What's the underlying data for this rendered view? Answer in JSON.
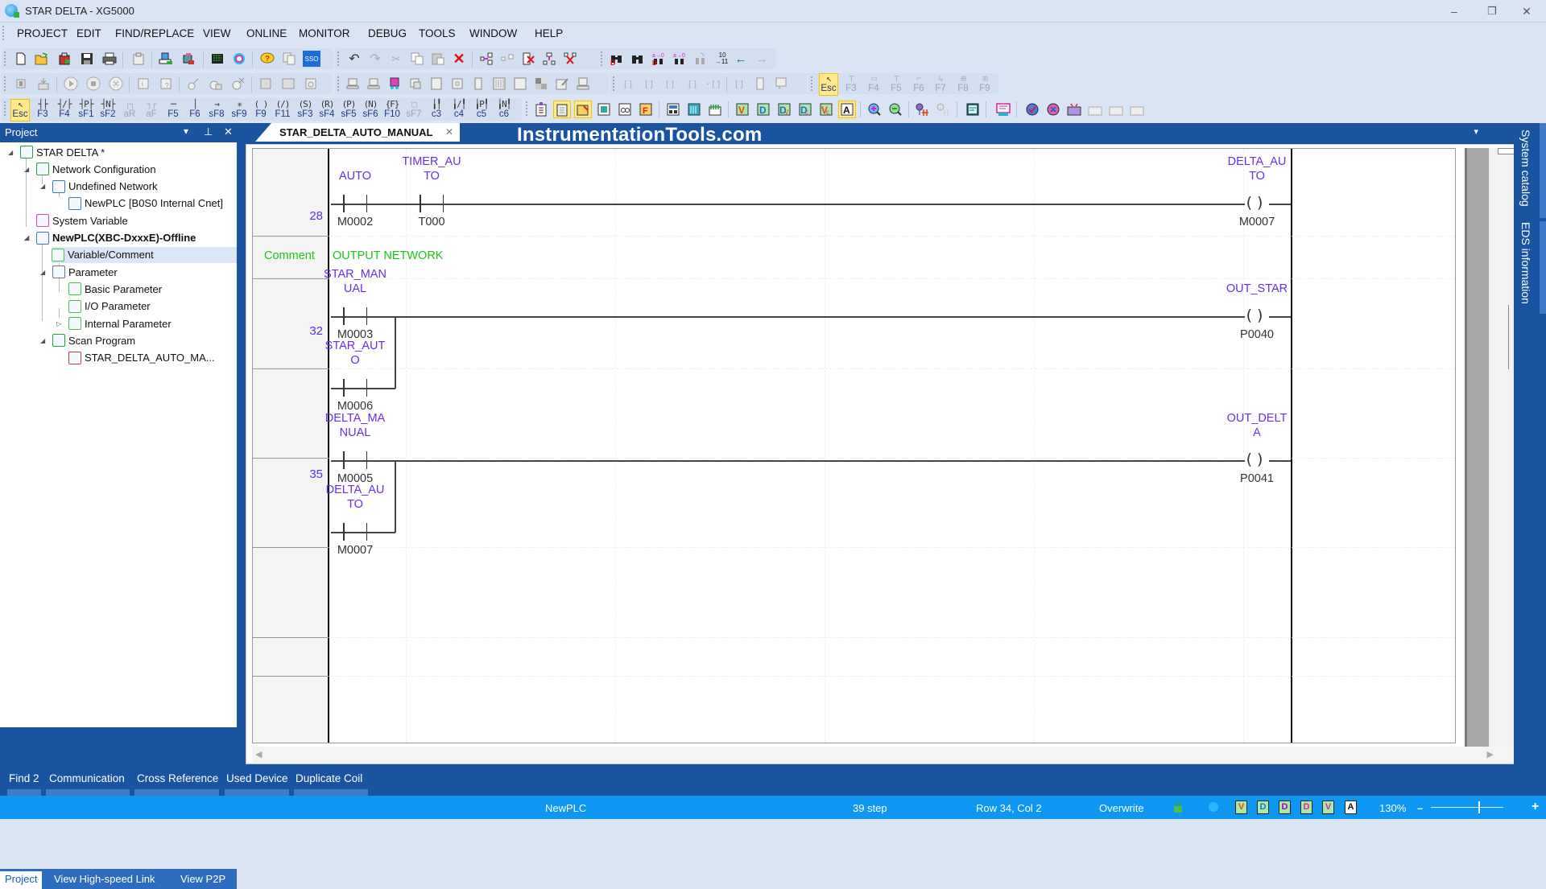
{
  "window": {
    "title": "STAR DELTA - XG5000",
    "app_icon": "xg5000-app-icon",
    "controls": {
      "minimize": "–",
      "restore": "❐",
      "close": "✕"
    }
  },
  "menu": [
    "PROJECT",
    "EDIT",
    "FIND/REPLACE",
    "VIEW",
    "ONLINE",
    "MONITOR",
    "DEBUG",
    "TOOLS",
    "WINDOW",
    "HELP"
  ],
  "toolbar_row1": {
    "file_group": [
      "new-project-icon",
      "open-project-icon",
      "open-from-plc-icon",
      "save-icon",
      "print-icon",
      "print-preview-icon",
      "connect-icon",
      "disconnect-icon",
      "monitor-icon",
      "scan-icon",
      "help-icon",
      "compare-icon",
      "sso-icon"
    ],
    "edit_group": [
      "undo-icon",
      "redo-icon",
      "cut-icon",
      "copy-icon",
      "paste-icon",
      "delete-icon",
      "insert-line-icon",
      "insert-cell-icon",
      "delete-line-icon",
      "insert-coil-line-icon",
      "delete-cell-icon"
    ],
    "find_group": [
      "find-device-icon",
      "find-icon",
      "replace-device-icon",
      "replace-icon",
      "find-again-icon",
      "goto-step-icon",
      "back-icon",
      "forward-icon"
    ],
    "goto_label": "10\n→11"
  },
  "toolbar_row2": {
    "online_group": [
      "mode-icon",
      "write-icon",
      "run-icon",
      "stop-icon",
      "pause-icon",
      "plc-info-icon",
      "plc-history-icon",
      "force-io-icon",
      "io-sync-icon",
      "clear-plc-icon",
      "io-info-icon",
      "io-skip-icon",
      "fault-mask-icon"
    ],
    "monitor_group": [
      "monitor-start-icon",
      "monitor-pause-icon",
      "trend-icon",
      "device-monitor-icon",
      "system-monitor-icon",
      "special-module-icon",
      "io-monitor-icon",
      "graph-icon",
      "bar-graph-icon",
      "memory-icon",
      "edit-monitor-icon",
      "communication-monitor-icon"
    ],
    "rung_group": [
      "rung-insert-icon",
      "rung-append-icon",
      "rung-split-icon",
      "rung-merge-icon",
      "rung-label-icon",
      "rung-comment-icon",
      "rung-out-comment-icon",
      "rung-edit-icon"
    ],
    "block_keys": [
      {
        "sym": "↖",
        "key": "Esc",
        "selected": true
      },
      {
        "sym": "⊤",
        "key": "F3"
      },
      {
        "sym": "▭",
        "key": "F4"
      },
      {
        "sym": "⊤",
        "key": "F5"
      },
      {
        "sym": "⌐",
        "key": "F6"
      },
      {
        "sym": "↳",
        "key": "F7"
      },
      {
        "sym": "⊞",
        "key": "F8",
        "disabled": true
      },
      {
        "sym": "⊞",
        "key": "F9",
        "disabled": true
      }
    ]
  },
  "toolbar_row3": {
    "ladder_keys": [
      {
        "sym": "↖",
        "key": "Esc",
        "selected": true
      },
      {
        "sym": "┤├",
        "key": "F3"
      },
      {
        "sym": "┤/├",
        "key": "F4"
      },
      {
        "sym": "┤P├",
        "key": "sF1"
      },
      {
        "sym": "┤N├",
        "key": "sF2"
      },
      {
        "sym": "┌┐",
        "key": "aR",
        "disabled": true
      },
      {
        "sym": "┐┌",
        "key": "aF",
        "disabled": true
      },
      {
        "sym": "─",
        "key": "F5"
      },
      {
        "sym": "│",
        "key": "F6"
      },
      {
        "sym": "→",
        "key": "sF8"
      },
      {
        "sym": "✳",
        "key": "sF9"
      },
      {
        "sym": "( )",
        "key": "F9"
      },
      {
        "sym": "(/)",
        "key": "F11"
      },
      {
        "sym": "(S)",
        "key": "sF3"
      },
      {
        "sym": "(R)",
        "key": "sF4"
      },
      {
        "sym": "(P)",
        "key": "sF5"
      },
      {
        "sym": "(N)",
        "key": "sF6"
      },
      {
        "sym": "{F}",
        "key": "F10"
      },
      {
        "sym": "□",
        "key": "sF7",
        "disabled": true
      },
      {
        "sym": "╽╿",
        "key": "c3"
      },
      {
        "sym": "╽/╿",
        "key": "c4"
      },
      {
        "sym": "╽P╿",
        "key": "c5"
      },
      {
        "sym": "╽N╿",
        "key": "c6"
      }
    ],
    "view_group": [
      "project-window-icon",
      "variable-window-icon",
      "message-window-icon",
      "monitor-window-icon",
      "find-window-icon",
      "function-list-icon",
      "io-list-icon",
      "cross-ref-icon",
      "used-device-icon",
      "variable-view-icon",
      "device-view-icon",
      "device-variable-view-icon",
      "device-comment-view-icon",
      "variable-comment-view-icon",
      "address-view-icon",
      "zoom-in-icon",
      "zoom-out-icon",
      "breakpoint-icon",
      "breakpoint-clear-icon",
      "output-window-icon",
      "comment-icon",
      "check-program-icon",
      "cancel-check-icon",
      "bookmark-icon",
      "bookmark-prev-icon",
      "bookmark-next-icon",
      "bookmark-clear-icon"
    ]
  },
  "project_panel": {
    "title": "Project",
    "header_buttons": {
      "dropdown": "▾",
      "pin": "⊥",
      "close": "✕"
    },
    "tree": [
      {
        "label": "STAR DELTA *",
        "level": 0,
        "icon": "project-icon",
        "expanded": true
      },
      {
        "label": "Network Configuration",
        "level": 1,
        "icon": "network-config-icon",
        "expanded": true
      },
      {
        "label": "Undefined Network",
        "level": 2,
        "icon": "network-icon",
        "expanded": true
      },
      {
        "label": "NewPLC [B0S0 Internal Cnet]",
        "level": 3,
        "icon": "plc-node-icon"
      },
      {
        "label": "System Variable",
        "level": 1,
        "icon": "system-variable-icon"
      },
      {
        "label": "NewPLC(XBC-DxxxE)-Offline",
        "level": 1,
        "icon": "plc-icon",
        "expanded": true,
        "bold": true
      },
      {
        "label": "Variable/Comment",
        "level": 2,
        "icon": "variable-comment-icon",
        "selected": true
      },
      {
        "label": "Parameter",
        "level": 2,
        "icon": "parameter-icon",
        "expanded": true
      },
      {
        "label": "Basic Parameter",
        "level": 3,
        "icon": "basic-parameter-icon"
      },
      {
        "label": "I/O Parameter",
        "level": 3,
        "icon": "io-parameter-icon"
      },
      {
        "label": "Internal Parameter",
        "level": 3,
        "icon": "internal-parameter-icon",
        "collapsed": true
      },
      {
        "label": "Scan Program",
        "level": 2,
        "icon": "scan-program-icon",
        "expanded": true
      },
      {
        "label": "STAR_DELTA_AUTO_MA...",
        "level": 3,
        "icon": "ladder-program-icon"
      }
    ],
    "bottom_tabs": [
      {
        "label": "Project",
        "active": true
      },
      {
        "label": "View High-speed Link"
      },
      {
        "label": "View P2P"
      }
    ]
  },
  "editor": {
    "tab_label": "STAR_DELTA_AUTO_MANUAL",
    "tab_close": "✕",
    "watermark": "InstrumentationTools.com",
    "menu_arrow": "▾",
    "comment_label": "Comment",
    "comment_text": "OUTPUT NETWORK",
    "rungs": [
      {
        "step": "28",
        "contacts": [
          {
            "name": [
              "AUTO"
            ],
            "address": "M0002"
          },
          {
            "name": [
              "TIMER_AU",
              "TO"
            ],
            "address": "T000"
          }
        ],
        "coil": {
          "name": [
            "DELTA_AU",
            "TO"
          ],
          "address": "M0007"
        }
      },
      {
        "step": "32",
        "contacts": [
          {
            "name": [
              "STAR_MAN",
              "UAL"
            ],
            "address": "M0003"
          }
        ],
        "parallel": [
          {
            "name": [
              "STAR_AUT",
              "O"
            ],
            "address": "M0006"
          }
        ],
        "coil": {
          "name": [
            "OUT_STAR"
          ],
          "address": "P0040"
        }
      },
      {
        "step": "35",
        "contacts": [
          {
            "name": [
              "DELTA_MA",
              "NUAL"
            ],
            "address": "M0005"
          }
        ],
        "parallel": [
          {
            "name": [
              "DELTA_AU",
              "TO"
            ],
            "address": "M0007"
          }
        ],
        "coil": {
          "name": [
            "OUT_DELT",
            "A"
          ],
          "address": "P0041"
        }
      }
    ]
  },
  "side_tabs": [
    "System catalog",
    "EDS information"
  ],
  "output_tabs": [
    "Find 2",
    "Communication",
    "Cross Reference",
    "Used Device",
    "Duplicate Coil"
  ],
  "status": {
    "plc": "NewPLC",
    "steps": "39 step",
    "position": "Row 34, Col 2",
    "mode": "Overwrite",
    "view_icons": [
      {
        "icon": "variable-view-icon",
        "letter": "V",
        "color": "#ff3b00"
      },
      {
        "icon": "device-view-icon",
        "letter": "D",
        "color": "#1c6fd9"
      },
      {
        "icon": "device-variable-view-icon",
        "letter": "D",
        "color": "#a000c8"
      },
      {
        "icon": "device-comment-view-icon",
        "letter": "D",
        "color": "#e0209a"
      },
      {
        "icon": "variable-comment-view-icon",
        "letter": "V",
        "color": "#e0209a"
      },
      {
        "icon": "address-view-icon",
        "letter": "A",
        "color": "#111111"
      }
    ],
    "zoom": "130%",
    "zoom_minus": "–",
    "zoom_plus": "+"
  },
  "colors": {
    "panel_blue": "#1a53a0",
    "status_blue": "#0d97f2",
    "variable_name": "#6a2cf2",
    "comment_green": "#1ec21e",
    "chrome": "#dae4f5"
  }
}
